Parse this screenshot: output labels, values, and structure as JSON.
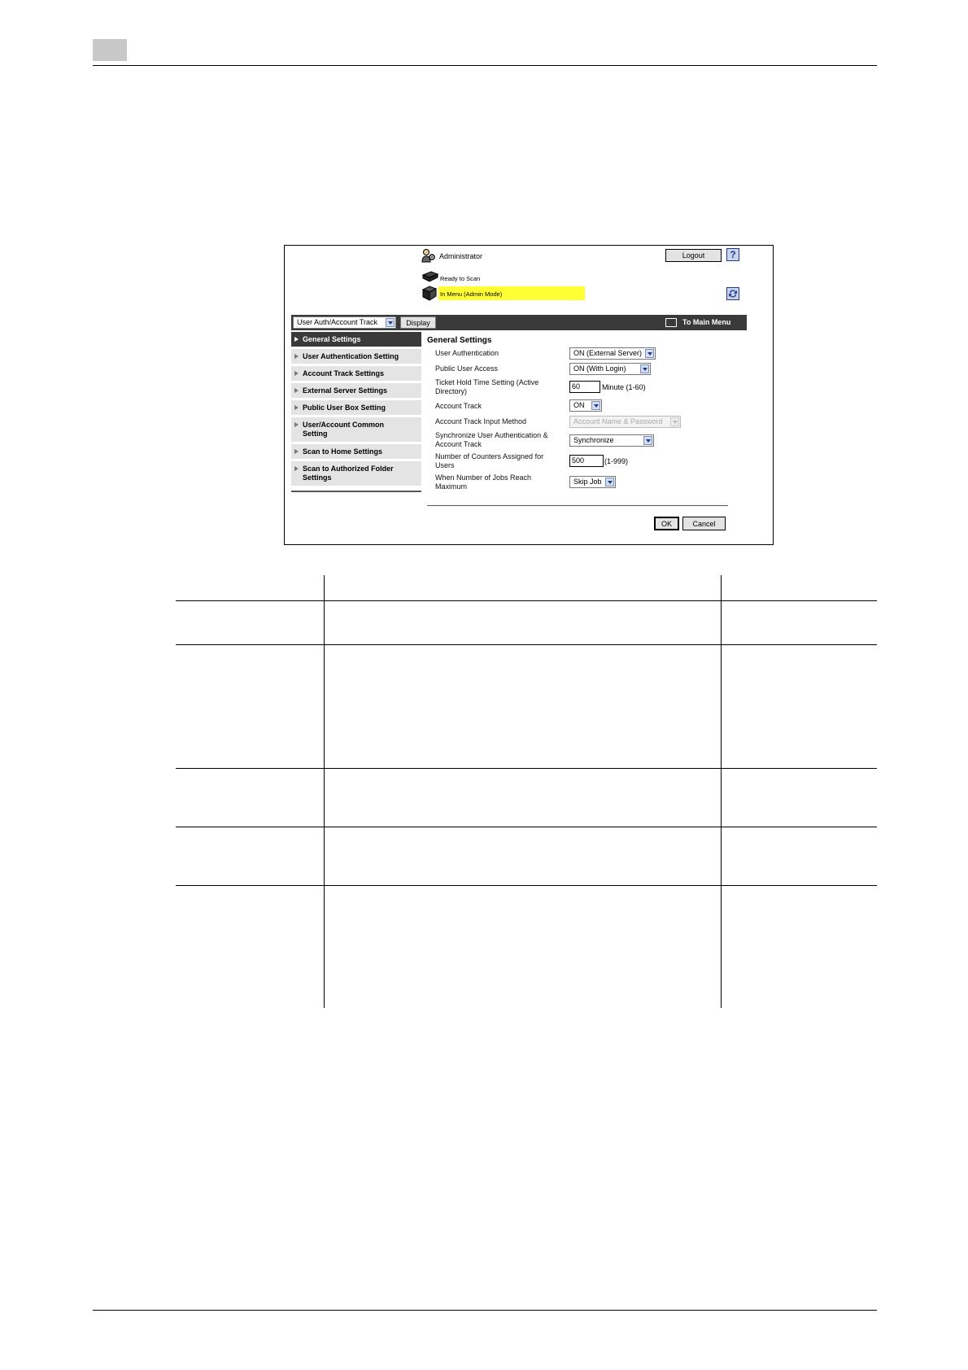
{
  "header": {
    "administrator_label": "Administrator",
    "logout_label": "Logout",
    "help_label": "?"
  },
  "status": {
    "ready": "Ready to Scan",
    "mode": "In Menu (Admin Mode)"
  },
  "navbar": {
    "category_selected": "User Auth/Account Track",
    "display_label": "Display",
    "main_menu_label": "To Main Menu"
  },
  "sidebar": {
    "items": [
      {
        "label": "General Settings",
        "active": true
      },
      {
        "label": "User Authentication Setting"
      },
      {
        "label": "Account Track Settings"
      },
      {
        "label": "External Server Settings"
      },
      {
        "label": "Public User Box Setting"
      },
      {
        "label": "User/Account Common Setting"
      },
      {
        "label": "Scan to Home Settings"
      },
      {
        "label": "Scan to Authorized Folder Settings"
      }
    ]
  },
  "form": {
    "title": "General Settings",
    "fields": [
      {
        "label": "User Authentication",
        "value": "ON (External Server)"
      },
      {
        "label": "Public User Access",
        "value": "ON (With Login)"
      },
      {
        "label": "Ticket Hold Time Setting (Active Directory)",
        "value": "60",
        "unit": "Minute (1-60)"
      },
      {
        "label": "Account Track",
        "value": "ON"
      },
      {
        "label": "Account Track Input Method",
        "value": "Account Name & Password"
      },
      {
        "label": "Synchronize User Authentication & Account Track",
        "value": "Synchronize"
      },
      {
        "label": "Number of Counters Assigned for Users",
        "value": "500",
        "unit": "(1-999)"
      },
      {
        "label": "When Number of Jobs Reach Maximum",
        "value": "Skip Job"
      }
    ],
    "ok_label": "OK",
    "cancel_label": "Cancel"
  },
  "colors": {
    "navbar": "#3a3a3a",
    "status_highlight": "#ffff33",
    "sidebar_bg": "#e4e4e4"
  }
}
